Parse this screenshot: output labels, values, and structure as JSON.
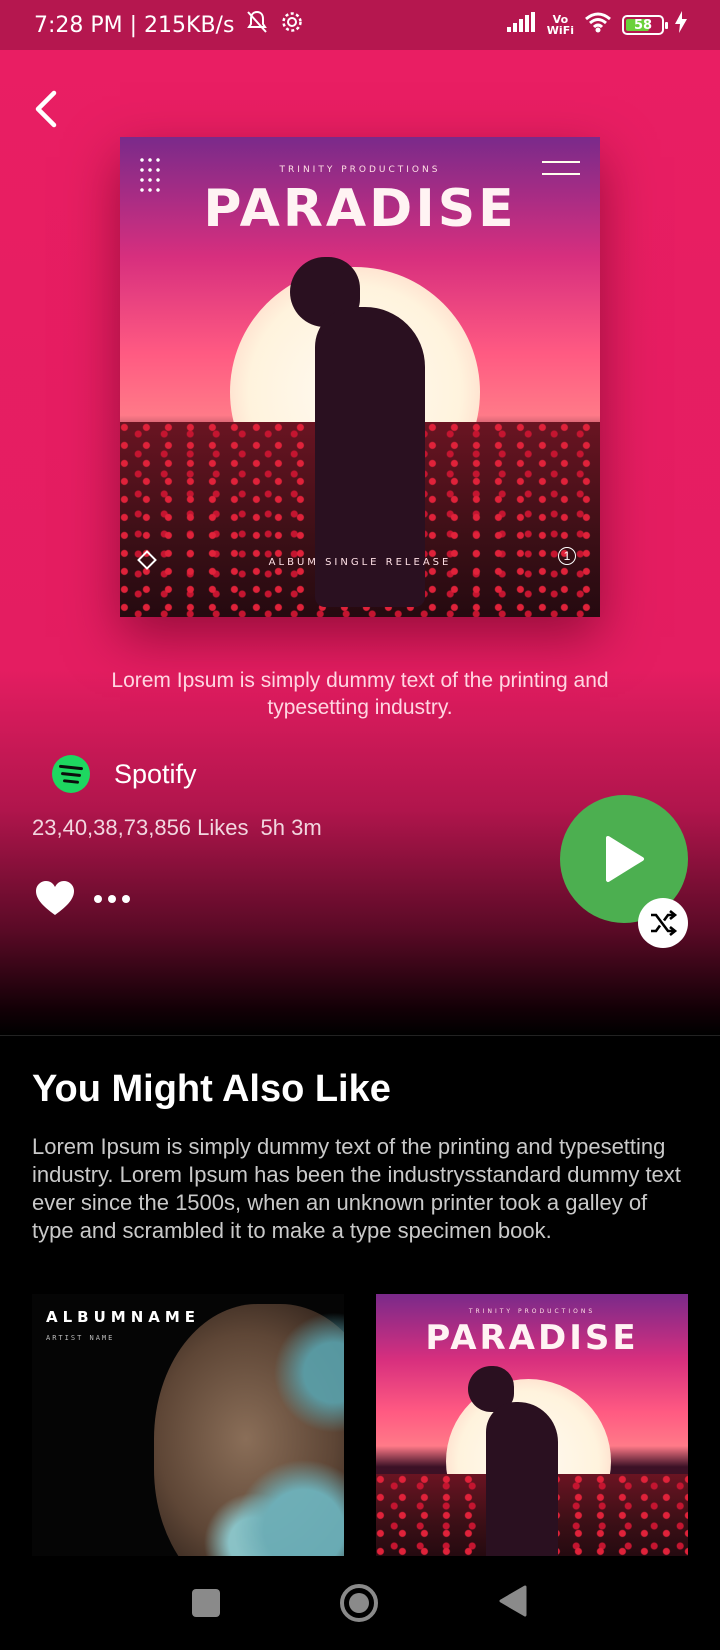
{
  "status_bar": {
    "time_speed": "7:28 PM | 215KB/s",
    "network_label_top": "Vo",
    "network_label_bottom": "WiFi",
    "battery_level": "58"
  },
  "album": {
    "cover": {
      "publisher": "TRINITY PRODUCTIONS",
      "title": "PARADISE",
      "caption": "ALBUM SINGLE RELEASE",
      "badge_number": "1"
    },
    "description": "Lorem Ipsum is simply dummy text of the printing and typesetting industry.",
    "source": "Spotify",
    "likes": "23,40,38,73,856 Likes",
    "duration": "5h 3m"
  },
  "recommendations": {
    "title": "You Might Also Like",
    "description": "Lorem Ipsum is simply dummy text of the printing and typesetting industry. Lorem Ipsum has been the industrysstandard dummy text ever since the 1500s, when an unknown printer took a galley of type and scrambled it to make a type specimen book.",
    "albums": [
      {
        "name": "ALBUMNAME",
        "artist": "ARTIST NAME"
      },
      {
        "publisher": "TRINITY PRODUCTIONS",
        "title": "PARADISE"
      }
    ]
  },
  "colors": {
    "accent": "#e91e63",
    "play_button": "#4caf50",
    "spotify_green": "#1ed760"
  },
  "icons": {
    "back": "chevron-left-icon",
    "heart": "heart-icon",
    "more": "more-horizontal-icon",
    "play": "play-icon",
    "shuffle": "shuffle-icon"
  }
}
